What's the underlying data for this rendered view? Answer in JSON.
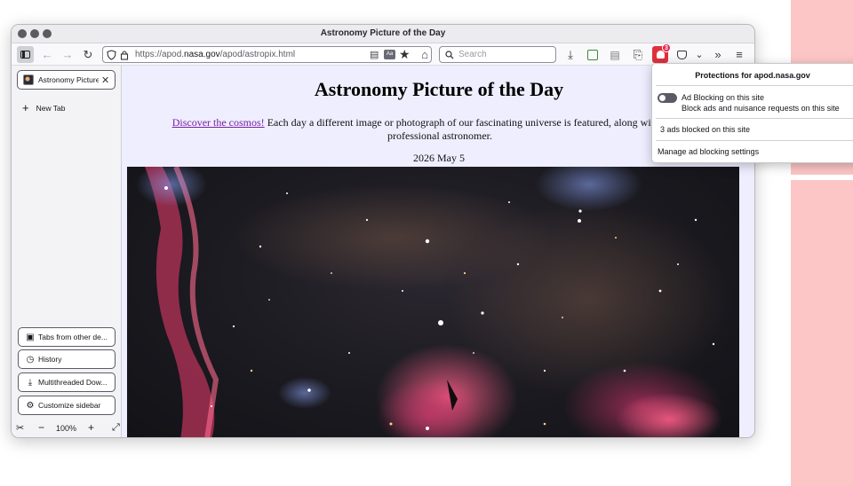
{
  "window": {
    "title": "Astronomy Picture of the Day"
  },
  "toolbar": {
    "url_prefix": "https://apod.",
    "url_domain": "nasa.gov",
    "url_suffix": "/apod/astropix.html",
    "search_placeholder": "Search",
    "blocked_badge": "3"
  },
  "sidebar": {
    "tab_label": "Astronomy Picture of the Day",
    "new_tab_label": "New Tab",
    "buttons": [
      {
        "label": "Tabs from other de...",
        "icon": "devices-icon"
      },
      {
        "label": "History",
        "icon": "history-icon"
      },
      {
        "label": "Multithreaded Dow...",
        "icon": "download-icon"
      },
      {
        "label": "Customize sidebar",
        "icon": "gear-icon"
      }
    ]
  },
  "statusbar": {
    "zoom": "100%"
  },
  "page": {
    "heading": "Astronomy Picture of the Day",
    "intro_link": "Discover the cosmos!",
    "intro_text_1": " Each day a different image or photograph of our fascinating universe is featured, along with a brief exp",
    "intro_text_2": "professional astronomer.",
    "date": "2026 May 5"
  },
  "popup": {
    "title": "Protections for apod.nasa.gov",
    "toggle_label": "Ad Blocking on this site",
    "toggle_desc": "Block ads and nuisance requests on this site",
    "blocked_text": "3 ads blocked on this site",
    "manage_link": "Manage ad blocking settings"
  }
}
